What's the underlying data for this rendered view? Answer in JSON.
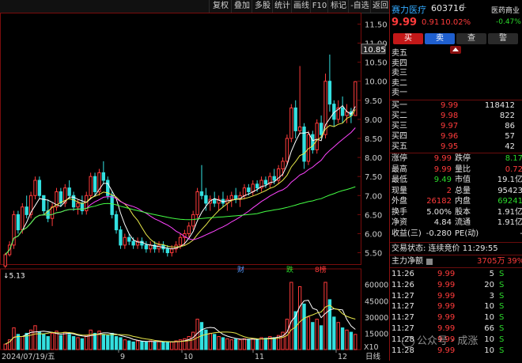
{
  "toolbar": {
    "items": [
      "复权",
      "叠加",
      "多股",
      "统计",
      "画线",
      "F10",
      "标记",
      "-自选",
      "返回"
    ]
  },
  "chart_main": {
    "price_ticks": [
      "11.50",
      "11.00",
      "10.50",
      "10.00",
      "9.50",
      "9.00",
      "8.50",
      "8.00",
      "7.50",
      "7.00",
      "6.50",
      "6.00",
      "5.50"
    ],
    "current_price_tag": "10.85",
    "low_marker": "5.13",
    "events": [
      "财",
      "跌",
      "8榜"
    ],
    "volume_ticks": [
      "60000",
      "45000",
      "30000",
      "15000"
    ],
    "volume_unit": "X10",
    "date_start": "2024/07/19/五",
    "date_marks": [
      "9",
      "10",
      "11",
      "12"
    ],
    "period": "日线",
    "watermark": "公众号 · 成涨"
  },
  "stock": {
    "name": "赛力医疗",
    "code": "603716",
    "flag": "L",
    "sector": "医药商业",
    "sector_change": "-0.47%",
    "price": "9.99",
    "change": "0.91",
    "change_pct": "10.02%"
  },
  "trade_buttons": {
    "buy": "买",
    "sell": "卖",
    "query": "查",
    "alert": "警"
  },
  "order_book": {
    "sells": [
      "卖五",
      "卖四",
      "卖三",
      "卖二",
      "卖一"
    ],
    "buys": [
      {
        "label": "买一",
        "price": "9.99",
        "vol": "118412"
      },
      {
        "label": "买二",
        "price": "9.98",
        "vol": "822"
      },
      {
        "label": "买三",
        "price": "9.97",
        "vol": "86"
      },
      {
        "label": "买四",
        "price": "9.96",
        "vol": "57"
      },
      {
        "label": "买五",
        "price": "9.95",
        "vol": "42"
      }
    ]
  },
  "quote": {
    "rows": [
      {
        "l1": "涨停",
        "v1": "9.99",
        "l2": "跌停",
        "v2": "8.17"
      },
      {
        "l1": "最高",
        "v1": "9.99",
        "l2": "量比",
        "v2": "0.72"
      },
      {
        "l1": "最低",
        "v1": "9.49",
        "l2": "市值",
        "v2": "19.1亿"
      },
      {
        "l1": "现量",
        "v1": "2",
        "l2": "总量",
        "v2": "95423"
      },
      {
        "l1": "外盘",
        "v1": "26182",
        "l2": "内盘",
        "v2": "69241"
      },
      {
        "l1": "换手",
        "v1": "5.00%",
        "l2": "股本",
        "v2": "1.91亿"
      },
      {
        "l1": "净资",
        "v1": "4.84",
        "l2": "流通",
        "v2": "1.91亿"
      },
      {
        "l1": "收益(三)",
        "v1": "-0.280",
        "l2": "PE(动)",
        "v2": "-"
      }
    ]
  },
  "trading_status": "交易状态: 连续竞价 11:29:55",
  "main_flow": {
    "label": "主力净额",
    "value": "3705万",
    "pct": "39%"
  },
  "ticks": [
    {
      "time": "11:26",
      "price": "9.99",
      "vol": "5",
      "dir": "S"
    },
    {
      "time": "11:26",
      "price": "9.99",
      "vol": "20",
      "dir": "S"
    },
    {
      "time": "11:27",
      "price": "9.99",
      "vol": "3",
      "dir": "S"
    },
    {
      "time": "11:27",
      "price": "9.99",
      "vol": "10",
      "dir": "S"
    },
    {
      "time": "11:27",
      "price": "9.99",
      "vol": "10",
      "dir": "S"
    },
    {
      "time": "11:27",
      "price": "9.99",
      "vol": "66",
      "dir": "S"
    },
    {
      "time": "11:28",
      "price": "9.99",
      "vol": "10",
      "dir": "S"
    },
    {
      "time": "11:28",
      "price": "9.99",
      "vol": "10",
      "dir": "S"
    }
  ],
  "colors": {
    "up": "#ff3b3b",
    "down": "#33e0e0",
    "ma_white": "#ffffff",
    "ma_yellow": "#e8e84a",
    "panel_border": "#8a1010"
  }
}
